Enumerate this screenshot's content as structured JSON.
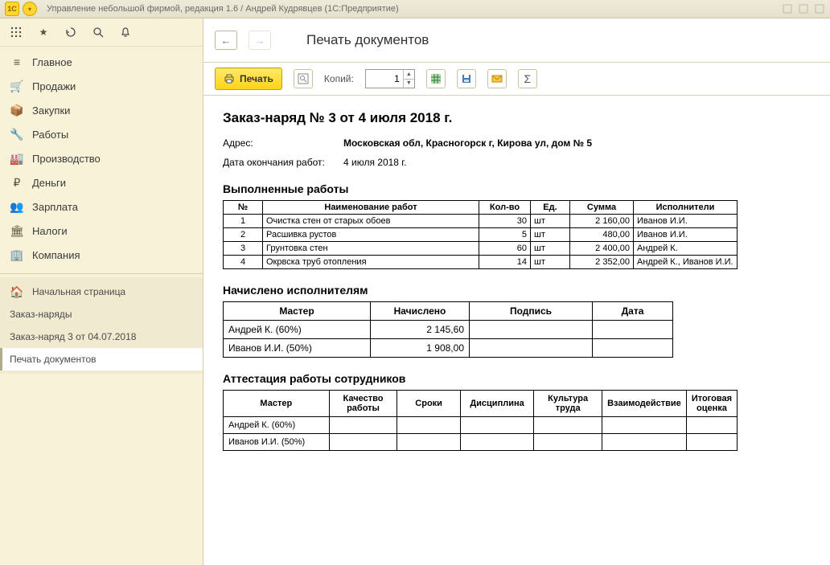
{
  "titlebar": {
    "badge": "1C",
    "title": "Управление небольшой фирмой, редакция 1.6 / Андрей Кудрявцев  (1С:Предприятие)"
  },
  "sidebar": {
    "nav": [
      {
        "icon": "≡",
        "label": "Главное"
      },
      {
        "icon": "🛒",
        "label": "Продажи"
      },
      {
        "icon": "📦",
        "label": "Закупки"
      },
      {
        "icon": "🔧",
        "label": "Работы"
      },
      {
        "icon": "🏭",
        "label": "Производство"
      },
      {
        "icon": "₽",
        "label": "Деньги"
      },
      {
        "icon": "👥",
        "label": "Зарплата"
      },
      {
        "icon": "🏛",
        "label": "Налоги"
      },
      {
        "icon": "🏢",
        "label": "Компания"
      }
    ],
    "sec": [
      {
        "icon": "🏠",
        "label": "Начальная страница"
      },
      {
        "icon": "",
        "label": "Заказ-наряды"
      },
      {
        "icon": "",
        "label": "Заказ-наряд 3 от 04.07.2018"
      },
      {
        "icon": "",
        "label": "Печать документов"
      }
    ]
  },
  "main": {
    "page_title": "Печать документов",
    "toolbar": {
      "print_label": "Печать",
      "copies_label": "Копий:",
      "copies_value": "1"
    },
    "doc": {
      "title": "Заказ-наряд № 3 от 4 июля 2018 г.",
      "address_label": "Адрес:",
      "address_value": "Московская обл, Красногорск г, Кирова ул, дом № 5",
      "end_label": "Дата окончания работ:",
      "end_value": "4 июля 2018 г.",
      "works_title": "Выполненные работы",
      "works_headers": [
        "№",
        "Наименование работ",
        "Кол-во",
        "Ед.",
        "Сумма",
        "Исполнители"
      ],
      "works": [
        {
          "n": "1",
          "name": "Очистка стен от старых обоев",
          "qty": "30",
          "u": "шт",
          "sum": "2 160,00",
          "perf": "Иванов И.И."
        },
        {
          "n": "2",
          "name": "Расшивка рустов",
          "qty": "5",
          "u": "шт",
          "sum": "480,00",
          "perf": "Иванов И.И."
        },
        {
          "n": "3",
          "name": "Грунтовка стен",
          "qty": "60",
          "u": "шт",
          "sum": "2 400,00",
          "perf": "Андрей К."
        },
        {
          "n": "4",
          "name": "Окрвска труб отопления",
          "qty": "14",
          "u": "шт",
          "sum": "2 352,00",
          "perf": "Андрей К., Иванов И.И."
        }
      ],
      "accr_title": "Начислено исполнителям",
      "accr_headers": [
        "Мастер",
        "Начислено",
        "Подпись",
        "Дата"
      ],
      "accr": [
        {
          "m": "Андрей К. (60%)",
          "a": "2 145,60"
        },
        {
          "m": "Иванов И.И. (50%)",
          "a": "1 908,00"
        }
      ],
      "att_title": "Аттестация работы сотрудников",
      "att_headers": [
        "Мастер",
        "Качество работы",
        "Сроки",
        "Дисциплина",
        "Культура труда",
        "Взаимодействие",
        "Итоговая оценка"
      ],
      "att": [
        {
          "m": "Андрей К. (60%)"
        },
        {
          "m": "Иванов И.И. (50%)"
        }
      ]
    }
  }
}
